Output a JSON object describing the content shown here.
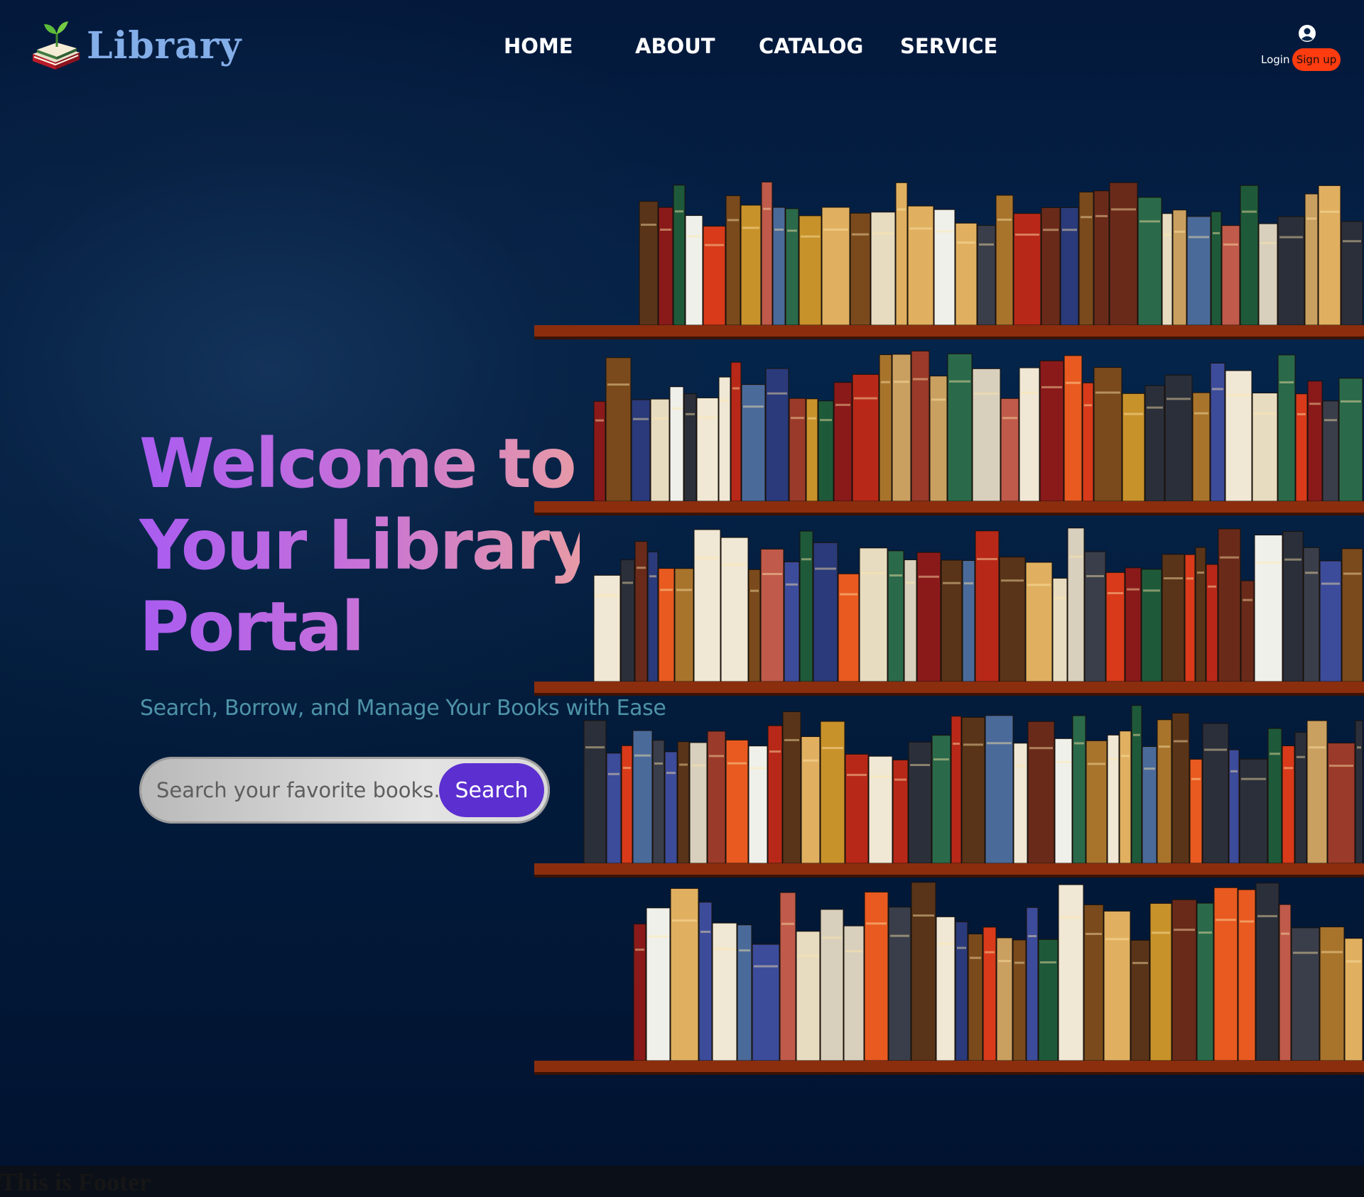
{
  "brand": {
    "name": "Library"
  },
  "nav": {
    "items": [
      "HOME",
      "ABOUT",
      "CATALOG",
      "SERVICE"
    ]
  },
  "user": {
    "login_label": "Login",
    "signup_label": "Sign up"
  },
  "hero": {
    "headline_lines": [
      "Welcome to",
      "Your Library",
      "Portal"
    ],
    "subtitle": "Search, Borrow, and Manage Your Books with Ease",
    "search": {
      "placeholder": "Search your favorite books...",
      "button_label": "Search"
    }
  },
  "footer": {
    "text": "This is Footer"
  },
  "colors": {
    "background": "#03183a",
    "accent_purple": "#5c2fd0",
    "signup": "#ff3b10",
    "logo": "#84aee8",
    "subtitle": "#4e93a8",
    "shelf_wood": "#8a2e0e"
  },
  "icons": {
    "logo": "book-sprout-icon",
    "user": "user-circle-icon"
  }
}
